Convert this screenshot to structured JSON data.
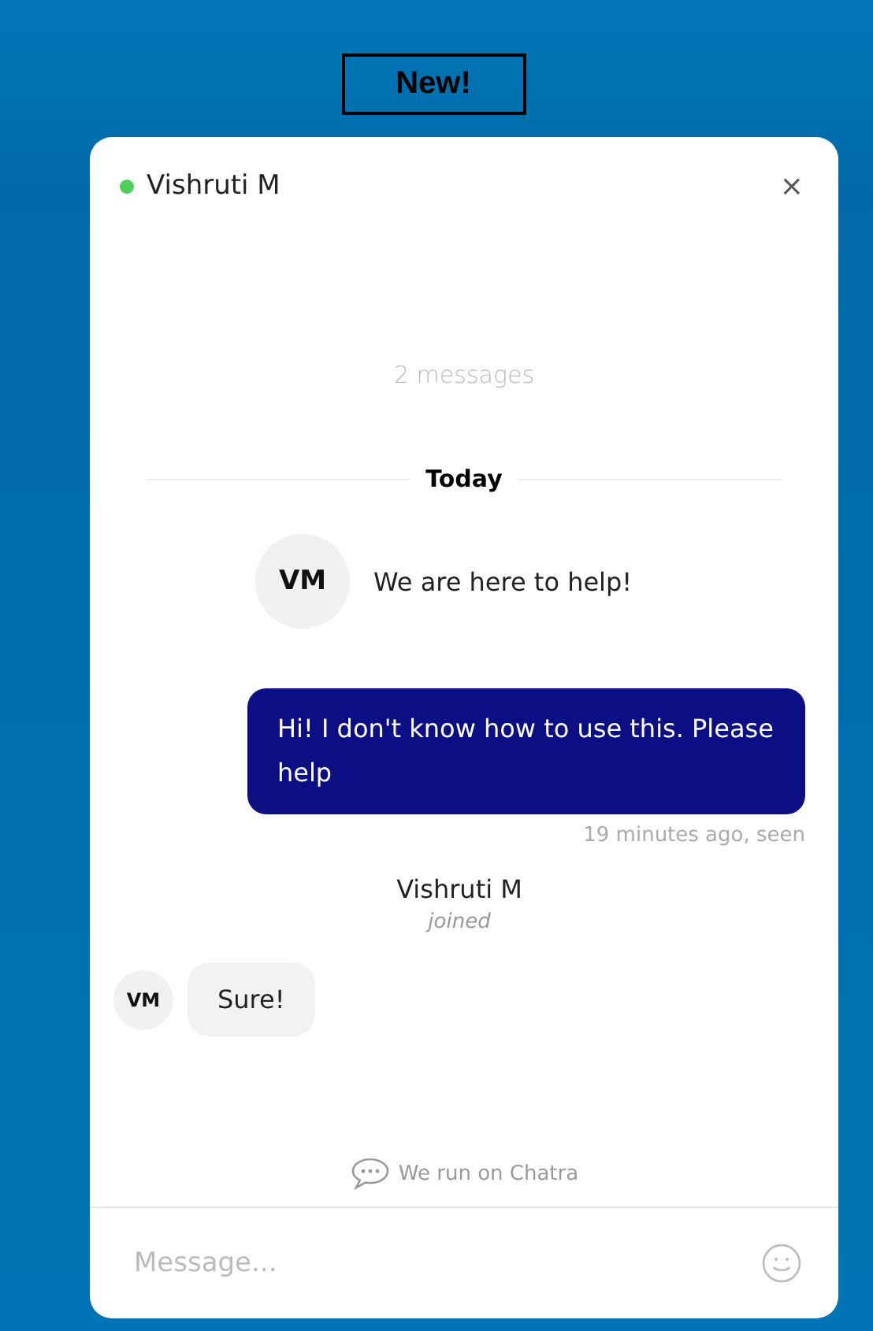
{
  "banner": {
    "label": "New!"
  },
  "header": {
    "agent_name": "Vishruti M",
    "online": true,
    "close": "×"
  },
  "history": {
    "count": "2 messages"
  },
  "day_divider": "Today",
  "messages": [
    {
      "kind": "intro",
      "avatar": "VM",
      "text": "We are here to help!"
    },
    {
      "kind": "outgoing",
      "text": "Hi! I don't know how to use this. Please help",
      "meta": "19 minutes ago, seen"
    },
    {
      "kind": "event",
      "name": "Vishruti M",
      "action": "joined"
    },
    {
      "kind": "incoming",
      "avatar": "VM",
      "text": "Sure!"
    }
  ],
  "branding": "We run on Chatra",
  "composer": {
    "placeholder": "Message..."
  }
}
